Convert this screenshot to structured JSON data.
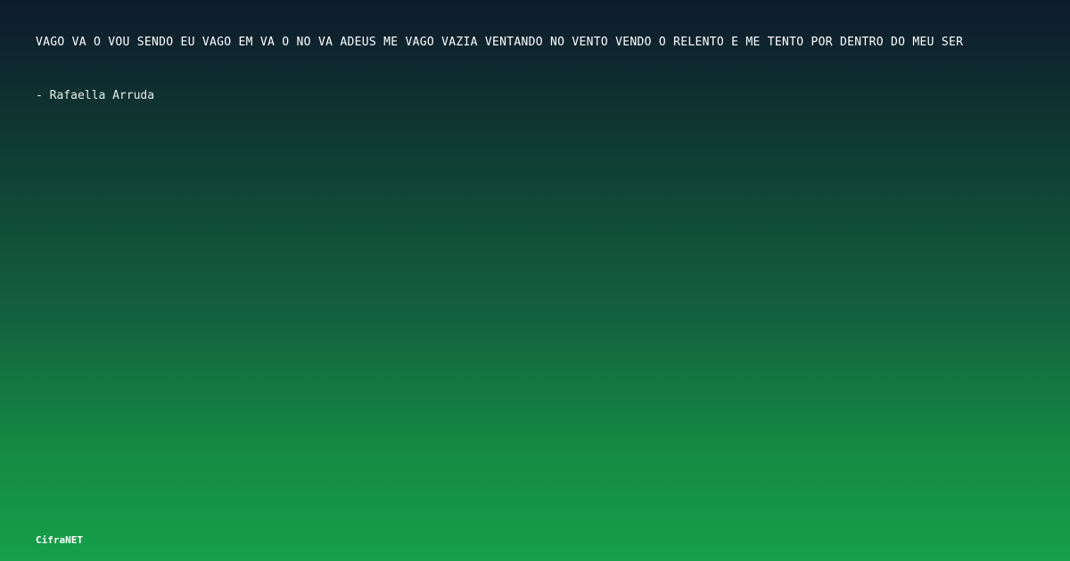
{
  "quote": {
    "text": "VAGO VÃ O VOU SENDO EU VAGO EM VÃ O NO VÃ  ADEUS ME VAGO VAZIA VENTANDO NO VENTO VENDO O RELENTO E ME TENTO POR DENTRO DO MEU SER",
    "author": "- Rafaella Arruda"
  },
  "brand": {
    "name": "CifraNET"
  },
  "colors": {
    "background_top": "#0e1a2c",
    "background_bottom": "#16a049",
    "text": "#ffffff"
  }
}
